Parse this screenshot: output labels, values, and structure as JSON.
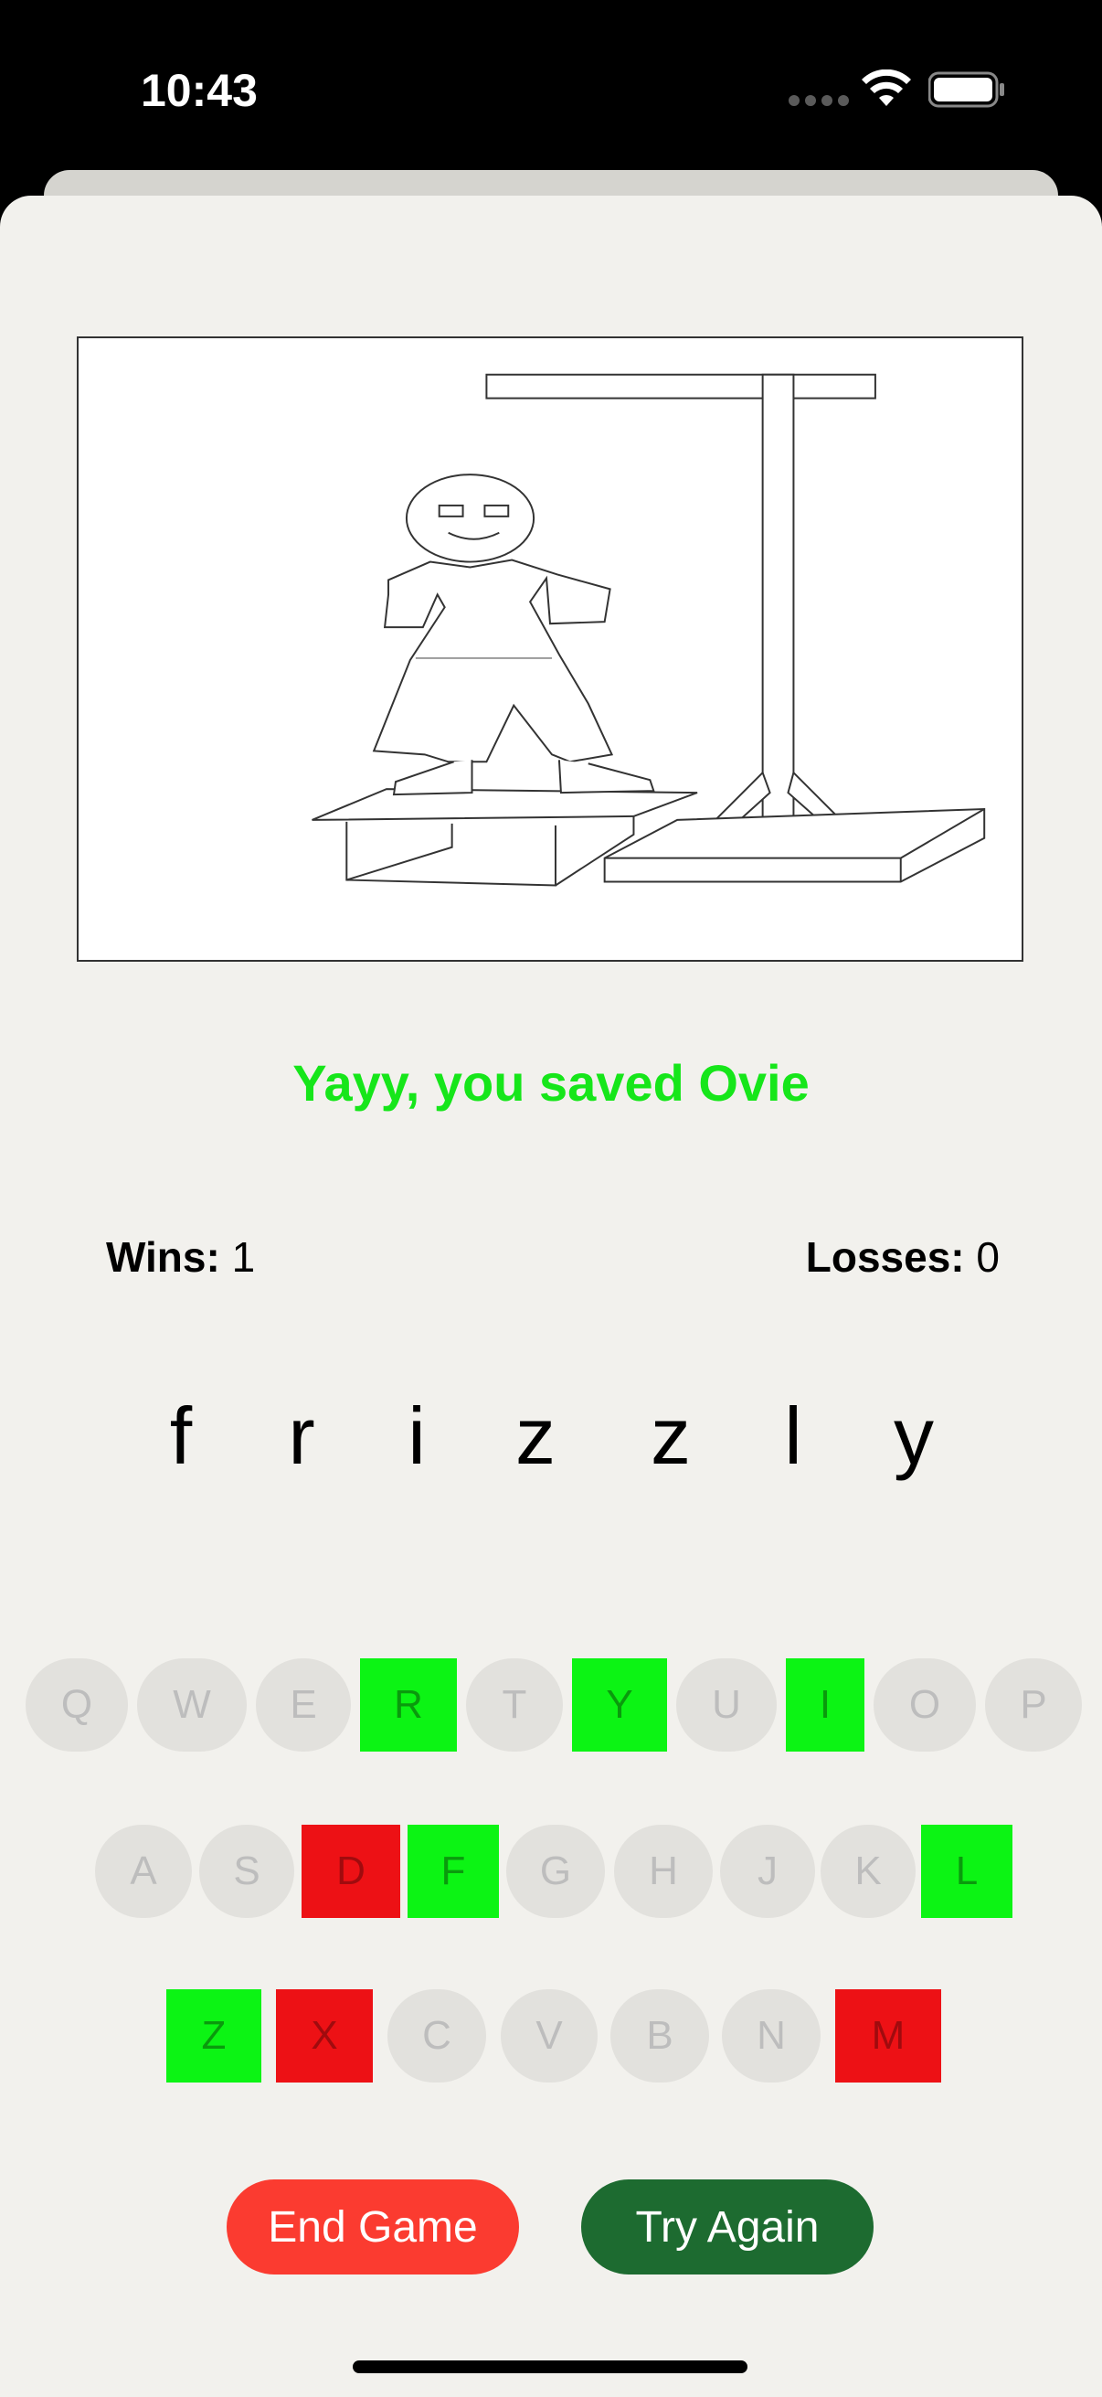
{
  "status_bar": {
    "time": "10:43",
    "icons": [
      "signal-dots-icon",
      "wifi-icon",
      "battery-icon"
    ]
  },
  "game": {
    "drawing_icon": "hangman-drawing",
    "message": "Yayy, you saved Ovie",
    "message_color": "#16e61a",
    "wins_label": "Wins:",
    "wins_value": "1",
    "losses_label": "Losses:",
    "losses_value": "0",
    "word_letters": [
      "f",
      "r",
      "i",
      "z",
      "z",
      "l",
      "y"
    ]
  },
  "keyboard": {
    "colors": {
      "hit": "#0cf414",
      "miss": "#ed1115",
      "unused": "#e2e1dd"
    },
    "rows": [
      [
        {
          "label": "Q",
          "state": "unused"
        },
        {
          "label": "W",
          "state": "unused"
        },
        {
          "label": "E",
          "state": "unused"
        },
        {
          "label": "R",
          "state": "hit"
        },
        {
          "label": "T",
          "state": "unused"
        },
        {
          "label": "Y",
          "state": "hit"
        },
        {
          "label": "U",
          "state": "unused"
        },
        {
          "label": "I",
          "state": "hit"
        },
        {
          "label": "O",
          "state": "unused"
        },
        {
          "label": "P",
          "state": "unused"
        }
      ],
      [
        {
          "label": "A",
          "state": "unused"
        },
        {
          "label": "S",
          "state": "unused"
        },
        {
          "label": "D",
          "state": "miss"
        },
        {
          "label": "F",
          "state": "hit"
        },
        {
          "label": "G",
          "state": "unused"
        },
        {
          "label": "H",
          "state": "unused"
        },
        {
          "label": "J",
          "state": "unused"
        },
        {
          "label": "K",
          "state": "unused"
        },
        {
          "label": "L",
          "state": "hit"
        }
      ],
      [
        {
          "label": "Z",
          "state": "hit"
        },
        {
          "label": "X",
          "state": "miss"
        },
        {
          "label": "C",
          "state": "unused"
        },
        {
          "label": "V",
          "state": "unused"
        },
        {
          "label": "B",
          "state": "unused"
        },
        {
          "label": "N",
          "state": "unused"
        },
        {
          "label": "M",
          "state": "miss"
        }
      ]
    ]
  },
  "buttons": {
    "end_game": "End Game",
    "end_game_color": "#fb3b30",
    "try_again": "Try Again",
    "try_again_color": "#1d6b30"
  }
}
